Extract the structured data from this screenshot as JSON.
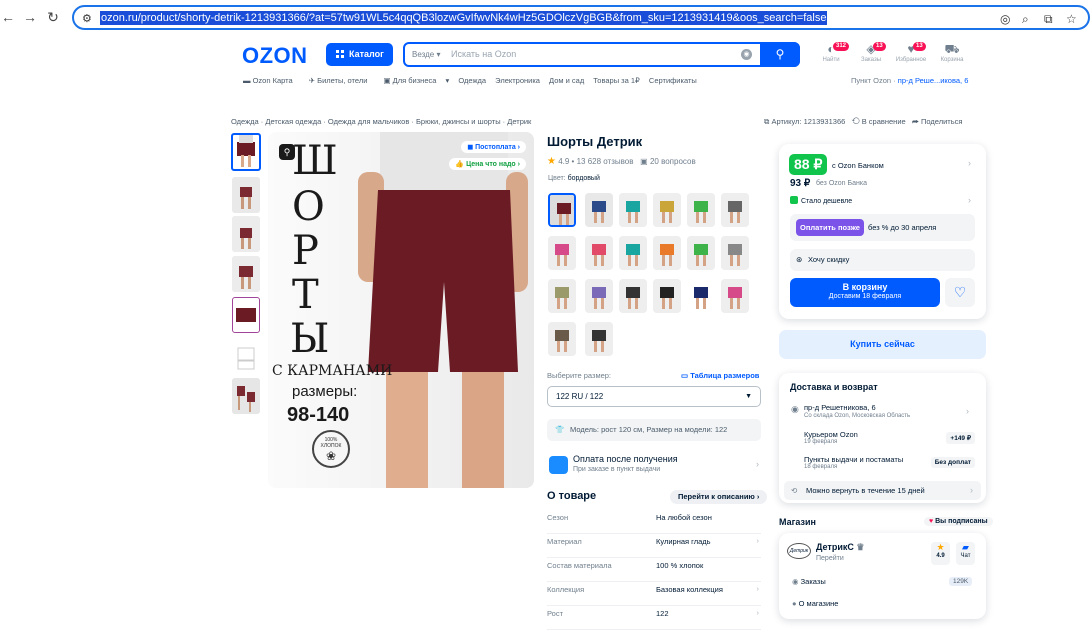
{
  "browser": {
    "url": "ozon.ru/product/shorty-detrik-1213931366/?at=57tw91WL5c4qqQB3lozwGvIfwvNk4wHz5GDOlczVgBGB&from_sku=1213931419&oos_search=false"
  },
  "header": {
    "logo": "OZON",
    "catalog": "Каталог",
    "search_scope": "Везде",
    "search_placeholder": "Искать на Ozon",
    "icons": [
      {
        "label": "Найти",
        "badge": "312"
      },
      {
        "label": "Заказы",
        "badge": "13"
      },
      {
        "label": "Избранное",
        "badge": "13"
      },
      {
        "label": "Корзина",
        "badge": ""
      }
    ]
  },
  "subnav": [
    "Ozon Карта",
    "Билеты, отели",
    "Для бизнеса",
    "Одежда",
    "Электроника",
    "Дом и сад",
    "Товары за 1₽",
    "Сертификаты"
  ],
  "pickup": {
    "prefix": "Пункт Ozon · ",
    "address": "пр-д Реше...икова, 6"
  },
  "breadcrumbs": "Одежда · Детская одежда · Одежда для мальчиков · Брюки, джинсы и шорты · Детрик",
  "article": "Артикул: 1213931366",
  "compare": "В сравнение",
  "share": "Поделиться",
  "image": {
    "letters": [
      "Ш",
      "О",
      "Р",
      "Т",
      "Ы"
    ],
    "pocket": "С КАРМАНАМИ",
    "sizes_lbl": "размеры:",
    "sizes": "98-140",
    "cotton": "100% ХЛОПОК",
    "pill1": "Постоплата",
    "pill2": "Цена что надо"
  },
  "product": {
    "title": "Шорты Детрик",
    "rating": "4.9 • 13 628 отзывов",
    "questions": "20 вопросов",
    "color_label": "Цвет:",
    "color_value": "бордовый",
    "size_label": "Выберите размер:",
    "size_table": "Таблица размеров",
    "size_value": "122 RU / 122",
    "model": "Модель: рост 120 см, Размер на модели: 122",
    "pay_title": "Оплата после получения",
    "pay_sub": "При заказе в пункт выдачи"
  },
  "about": {
    "title": "О товаре",
    "link": "Перейти к описанию",
    "rows": [
      {
        "k": "Сезон",
        "v": "На любой сезон"
      },
      {
        "k": "Материал",
        "v": "Кулирная гладь"
      },
      {
        "k": "Состав материала",
        "v": "100 % хлопок"
      },
      {
        "k": "Коллекция",
        "v": "Базовая коллекция"
      },
      {
        "k": "Рост",
        "v": "122"
      }
    ]
  },
  "price": {
    "ozon": "88 ₽",
    "ozon_label": "с Ozon Банком",
    "regular": "93 ₽",
    "regular_label": "без Ozon Банка",
    "cheaper": "Стало дешевле",
    "later_btn": "Оплатить позже",
    "later_txt": "без % до 30 апреля",
    "discount": "Хочу скидку",
    "cart": "В корзину",
    "cart_sub": "Доставим 18 февраля",
    "buy_now": "Купить сейчас"
  },
  "delivery": {
    "title": "Доставка и возврат",
    "addr": "пр-д Решетникова, 6",
    "addr_sub": "Со склада Ozon, Московская Область",
    "courier": "Курьером Ozon",
    "courier_date": "19 февраля",
    "courier_price": "+149 ₽",
    "points": "Пункты выдачи и постаматы",
    "points_date": "18 февраля",
    "points_price": "Без доплат",
    "return": "Можно вернуть в течение 15 дней"
  },
  "shop": {
    "title": "Магазин",
    "subscribed": "Вы подписаны",
    "logo": "Детрик",
    "name": "ДетрикС",
    "go": "Перейти",
    "rating": "4.9",
    "chat": "Чат",
    "orders": "Заказы",
    "orders_count": "129K",
    "about": "О магазине"
  },
  "colors": {
    "accent": "#005bff",
    "green": "#10c44c",
    "purple": "#7b53e8",
    "shorts": "#6b1b24"
  }
}
